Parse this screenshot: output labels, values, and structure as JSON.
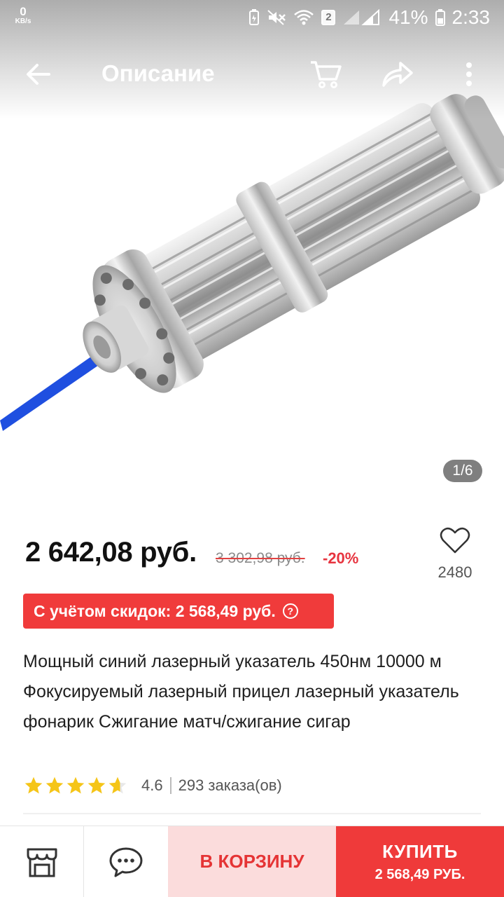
{
  "status_bar": {
    "net_speed_value": "0",
    "net_speed_unit": "KB/s",
    "sim_slot": "2",
    "battery_percent": "41%",
    "time": "2:33"
  },
  "app_bar": {
    "title": "Описание",
    "icons": [
      "back-arrow-icon",
      "cart-icon",
      "share-icon",
      "more-vert-icon"
    ]
  },
  "gallery": {
    "image_counter": "1/6"
  },
  "product": {
    "price": "2 642,08 руб.",
    "old_price": "3 302,98 руб.",
    "discount": "-20%",
    "wishlist_count": "2480",
    "coupon_text": "С учётом скидок: 2 568,49 руб.",
    "coupon_help_icon": "?",
    "title": "Мощный синий лазерный указатель 450нм 10000 м Фокусируемый лазерный прицел лазерный указатель фонарик Сжигание матч/сжигание сигар",
    "rating": {
      "stars": 4.6,
      "score": "4.6",
      "orders": "293 заказа(ов)"
    }
  },
  "bottom_bar": {
    "store_icon": "store-icon",
    "chat_icon": "chat-icon",
    "add_to_cart": "В КОРЗИНУ",
    "buy_label": "КУПИТЬ",
    "buy_price": "2 568,49 РУБ."
  },
  "colors": {
    "accent_red": "#ef3a3a",
    "cart_bg": "#fbdcdc",
    "discount_red": "#e7343f",
    "star_yellow": "#f5c518",
    "laser_blue": "#1f4fe0"
  }
}
